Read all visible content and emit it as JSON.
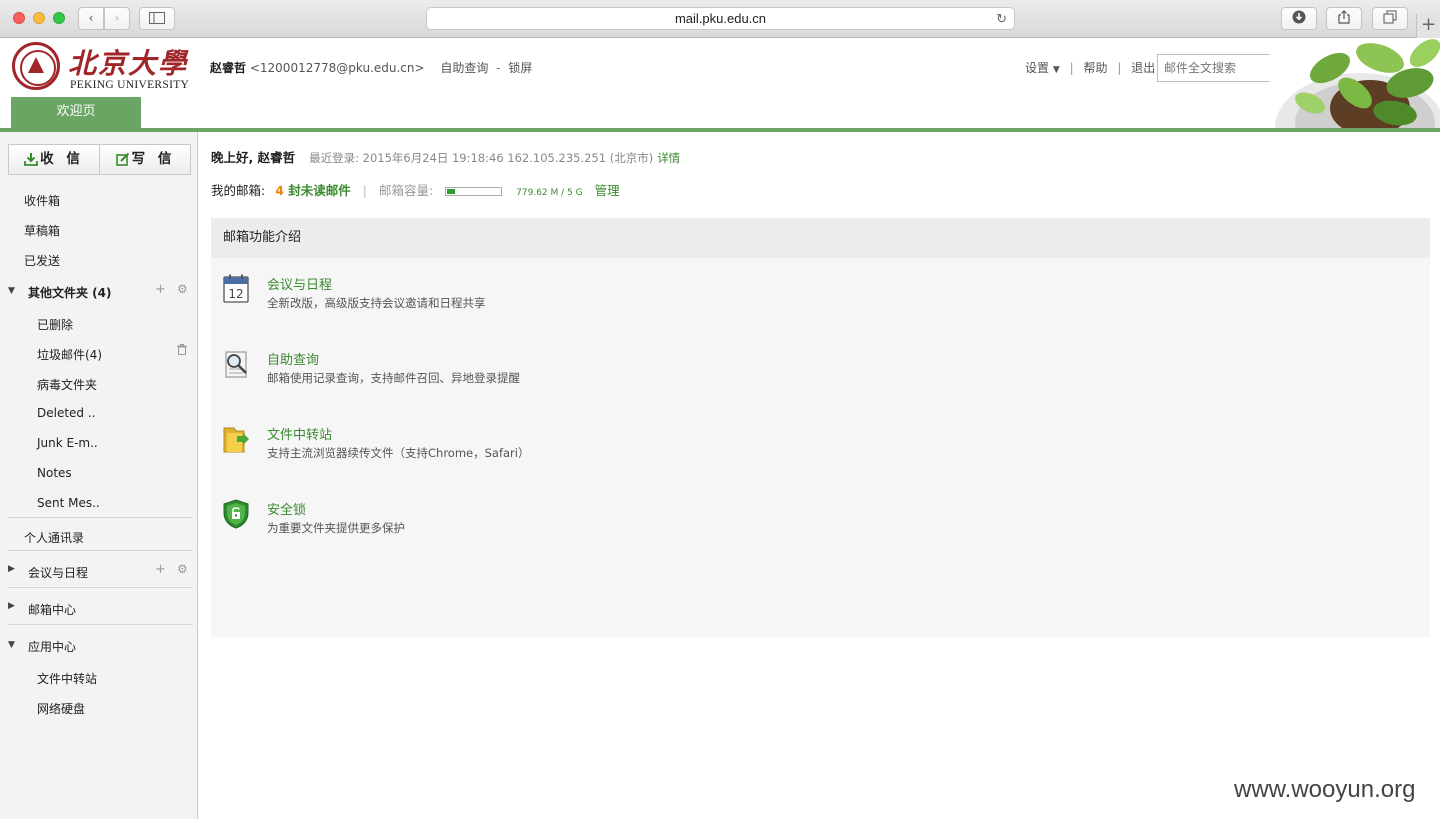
{
  "browser": {
    "url": "mail.pku.edu.cn"
  },
  "logo": {
    "cn": "北京大學",
    "en": "PEKING UNIVERSITY"
  },
  "header": {
    "welcome_tab": "欢迎页",
    "user_name": "赵睿哲",
    "user_email": "<1200012778@pku.edu.cn>",
    "self_query": "自助查询",
    "dash": "-",
    "lock": "锁屏",
    "settings": "设置",
    "help": "帮助",
    "logout": "退出",
    "bar": "|",
    "search_placeholder": "邮件全文搜索"
  },
  "sidebar": {
    "receive": "收 信",
    "compose": "写 信",
    "inbox": "收件箱",
    "drafts": "草稿箱",
    "sent": "已发送",
    "other_folders": "其他文件夹 (4)",
    "deleted": "已删除",
    "junk": "垃圾邮件(4)",
    "virus": "病毒文件夹",
    "deleted_en": "Deleted ..",
    "junk_en": "Junk E-m..",
    "notes": "Notes",
    "sent_en": "Sent Mes..",
    "contacts": "个人通讯录",
    "calendar": "会议与日程",
    "mail_center": "邮箱中心",
    "app_center": "应用中心",
    "file_transfer": "文件中转站",
    "netdisk": "网络硬盘"
  },
  "main": {
    "greeting": "晚上好, 赵睿哲",
    "last_login": "最近登录: 2015年6月24日 19:18:46 162.105.235.251 (北京市)",
    "details": "详情",
    "my_mailbox": "我的邮箱:",
    "unread_count": "4",
    "unread_label": "封未读邮件",
    "quota_label": "邮箱容量:",
    "quota_fraction": 0.15,
    "quota_text": "779.62 M / 5 G",
    "manage": "管理",
    "pipe": "|",
    "panel_title": "邮箱功能介绍",
    "features": [
      {
        "title": "会议与日程",
        "desc": "全新改版，高级版支持会议邀请和日程共享",
        "icon": "calendar-icon",
        "icon_text": "12"
      },
      {
        "title": "自助查询",
        "desc": "邮箱使用记录查询，支持邮件召回、异地登录提醒",
        "icon": "magnifier-doc-icon"
      },
      {
        "title": "文件中转站",
        "desc": "支持主流浏览器续传文件（支持Chrome，Safari）",
        "icon": "folder-transfer-icon"
      },
      {
        "title": "安全锁",
        "desc": "为重要文件夹提供更多保护",
        "icon": "shield-lock-icon"
      }
    ]
  },
  "watermark": "www.wooyun.org",
  "colors": {
    "brand_green": "#6aa563",
    "link_green": "#3a8a2f",
    "unread_orange": "#f08300",
    "pku_red": "#a1262a"
  }
}
